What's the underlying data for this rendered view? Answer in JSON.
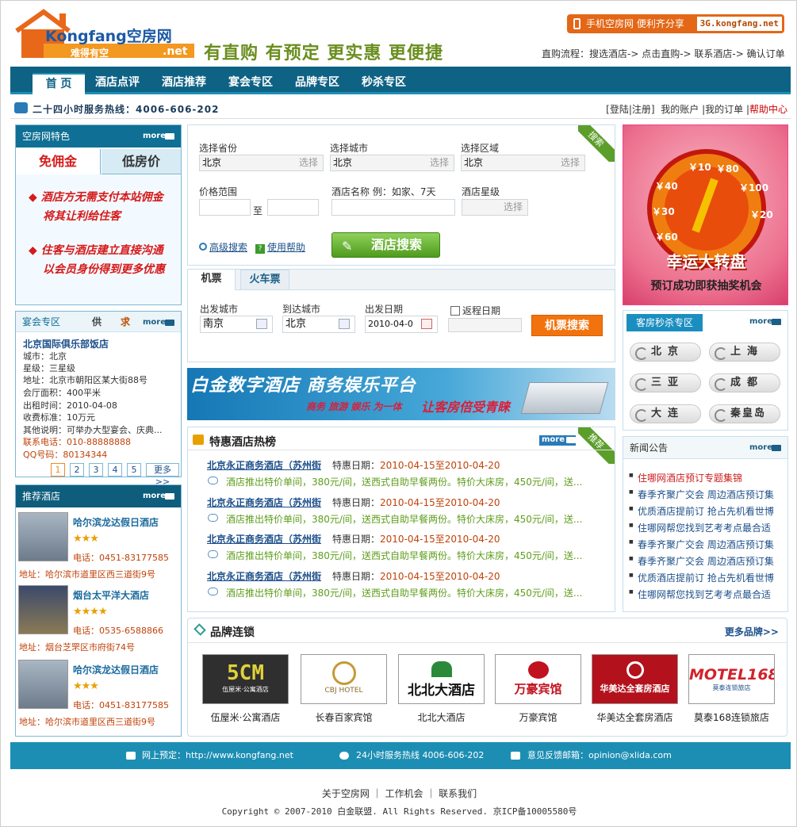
{
  "header": {
    "logo_text": "Kongfang空房网",
    "logo_domain": ".net",
    "logo_tagline": "难得有空",
    "slogan": "有直购 有预定 更实惠 更便捷",
    "mobile_label": "手机空房网 便利齐分享",
    "mobile_url": "3G.kongfang.net",
    "flow": "直购流程：搜选酒店-> 点击直购-> 联系酒店-> 确认订单"
  },
  "nav": [
    "首 页",
    "酒店点评",
    "酒店推荐",
    "宴会专区",
    "品牌专区",
    "秒杀专区"
  ],
  "hotline": {
    "text": "二十四小时服务热线：4006-606-202",
    "login": "登陆",
    "register": "注册",
    "account": "我的账户",
    "orders": "我的订单",
    "help": "帮助中心"
  },
  "features": {
    "title": "空房网特色",
    "more": "more",
    "tab_active": "免佣金",
    "tab_other": "低房价",
    "line1a": "◆ 酒店方无需支付本站佣金",
    "line1b": "将其让利给住客",
    "line2a": "◆ 住客与酒店建立直接沟通",
    "line2b": "以会员身份得到更多优惠"
  },
  "banquet": {
    "title": "宴会专区",
    "supply": "供",
    "demand": "求",
    "more": "more",
    "name": "北京国际俱乐部饭店",
    "city": "城市：北京",
    "stars": "星级：三星级",
    "address": "地址：北京市朝阳区某大街88号",
    "area": "会厅面积：400平米",
    "date": "出租时间：2010-04-08",
    "fee": "收费标准：10万元",
    "other": "其他说明：可举办大型宴会、庆典...",
    "phone": "联系电话：010-88888888",
    "qq": "QQ号码：80134344",
    "pages": [
      "1",
      "2",
      "3",
      "4",
      "5"
    ],
    "more_pages": "更多>>"
  },
  "recommend": {
    "title": "推荐酒店",
    "more": "more",
    "hotels": [
      {
        "name": "哈尔滨龙达假日酒店",
        "stars": "★★★",
        "tel": "电话：0451-83177585",
        "addr": "地址：哈尔滨市道里区西三道街9号"
      },
      {
        "name": "烟台太平洋大酒店",
        "stars": "★★★★",
        "tel": "电话：0535-6588866",
        "addr": "地址：烟台芝罘区市府街74号"
      },
      {
        "name": "哈尔滨龙达假日酒店",
        "stars": "★★★",
        "tel": "电话：0451-83177585",
        "addr": "地址：哈尔滨市道里区西三道街9号"
      }
    ]
  },
  "search": {
    "ribbon": "搜索",
    "province_label": "选择省份",
    "province_value": "北京",
    "city_label": "选择城市",
    "city_value": "北京",
    "district_label": "选择区域",
    "district_value": "北京",
    "choose": "选择",
    "price_label": "价格范围",
    "price_to": "至",
    "hotel_label": "酒店名称 例：如家、7天",
    "star_label": "酒店星级",
    "advanced": "高级搜索",
    "help": "使用帮助",
    "button": "酒店搜索"
  },
  "flight": {
    "tab_flight": "机票",
    "tab_train": "火车票",
    "from_label": "出发城市",
    "from_value": "南京",
    "to_label": "到达城市",
    "to_value": "北京",
    "date_label": "出发日期",
    "date_value": "2010-04-0",
    "return_label": "返程日期",
    "button": "机票搜索"
  },
  "banner": {
    "main": "白金数字酒店 商务娱乐平台",
    "sub": "商务 旅游 娱乐 为一体",
    "tag": "让客房倍受青睐"
  },
  "deals": {
    "title": "特惠酒店热榜",
    "more": "more",
    "ribbon": "推荐",
    "items": [
      {
        "name": "北京永正商务酒店（苏州街",
        "label": "特惠日期：",
        "date": "2010-04-15至2010-04-20",
        "desc": "酒店推出特价单间，380元/间，送西式自助早餐两份。特价大床房，450元/间，送..."
      },
      {
        "name": "北京永正商务酒店（苏州街",
        "label": "特惠日期：",
        "date": "2010-04-15至2010-04-20",
        "desc": "酒店推出特价单间，380元/间，送西式自助早餐两份。特价大床房，450元/间，送..."
      },
      {
        "name": "北京永正商务酒店（苏州街",
        "label": "特惠日期：",
        "date": "2010-04-15至2010-04-20",
        "desc": "酒店推出特价单间，380元/间，送西式自助早餐两份。特价大床房，450元/间，送..."
      },
      {
        "name": "北京永正商务酒店（苏州街",
        "label": "特惠日期：",
        "date": "2010-04-15至2010-04-20",
        "desc": "酒店推出特价单间，380元/间，送西式自助早餐两份。特价大床房，450元/间，送..."
      }
    ]
  },
  "brands": {
    "title": "品牌连锁",
    "more": "更多品牌>>",
    "items": [
      {
        "name": "伍屋米·公寓酒店",
        "logo": "5CM",
        "logo_sub": "伍屋米·公寓酒店",
        "bg": "#2f2f2f",
        "fg": "#e0d23a"
      },
      {
        "name": "长春百家宾馆",
        "logo": "CBJ HOTEL",
        "logo_sub": "",
        "bg": "#ffffff",
        "fg": "#8a6a2a"
      },
      {
        "name": "北北大酒店",
        "logo": "北北大酒店",
        "logo_sub": "",
        "bg": "#ffffff",
        "fg": "#111111"
      },
      {
        "name": "万豪宾馆",
        "logo": "万豪宾馆",
        "logo_sub": "",
        "bg": "#ffffff",
        "fg": "#c1121f"
      },
      {
        "name": "华美达全套房酒店",
        "logo": "华美达全套房酒店",
        "logo_sub": "",
        "bg": "#b3121c",
        "fg": "#ffffff"
      },
      {
        "name": "莫泰168连锁旅店",
        "logo": "MOTEL168",
        "logo_sub": "莫泰连锁旅店",
        "bg": "#ffffff",
        "fg": "#d2222b"
      }
    ]
  },
  "wheel": {
    "title": "幸运大转盘",
    "sub": "预订成功即获抽奖机会",
    "numbers": [
      "￥40",
      "￥10",
      "￥80",
      "￥100",
      "￥20",
      "￥30",
      "￥60"
    ]
  },
  "flash": {
    "title": "客房秒杀专区",
    "more": "more",
    "cities": [
      "北京",
      "上海",
      "三亚",
      "成都",
      "大连",
      "秦皇岛"
    ]
  },
  "news": {
    "title": "新闻公告",
    "more": "more",
    "items": [
      "住哪网酒店预订专题集锦",
      "春季齐聚广交会 周边酒店预订集",
      "优质酒店提前订 抢占先机看世博",
      "住哪网帮您找到艺考考点最合适",
      "春季齐聚广交会 周边酒店预订集",
      "春季齐聚广交会 周边酒店预订集",
      "优质酒店提前订 抢占先机看世博",
      "住哪网帮您找到艺考考点最合适"
    ]
  },
  "footer": {
    "online": "网上预定：http://www.kongfang.net",
    "hotline": "24小时服务热线 4006-606-202",
    "feedback": "意见反馈邮箱：opinion@xlida.com",
    "links": "关于空房网 ｜ 工作机会 ｜ 联系我们",
    "copyright": "Copyright © 2007-2010 白金联盟. All Rights Reserved. 京ICP备10005580号"
  }
}
